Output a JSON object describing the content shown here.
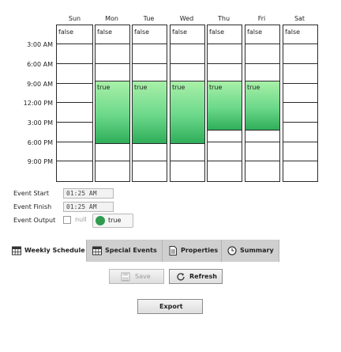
{
  "schedule": {
    "days": [
      "Sun",
      "Mon",
      "Tue",
      "Wed",
      "Thu",
      "Fri",
      "Sat"
    ],
    "time_labels": [
      "3:00 AM",
      "6:00 AM",
      "9:00 AM",
      "12:00 PM",
      "3:00 PM",
      "6:00 PM",
      "9:00 PM"
    ],
    "default_value": "false",
    "active_value": "true",
    "active_block_days": [
      "Mon",
      "Tue",
      "Wed",
      "Thu",
      "Fri"
    ]
  },
  "event": {
    "start_label": "Event Start",
    "start_value": "01:25 AM",
    "finish_label": "Event Finish",
    "finish_value": "01:25 AM",
    "output_label": "Event Output",
    "null_label": "null",
    "output_value": "true",
    "output_color": "#2f9b4f"
  },
  "tabs": [
    {
      "label": "Weekly Schedule",
      "icon": "calendar-grid-icon",
      "active": true
    },
    {
      "label": "Special Events",
      "icon": "calendar-grid-icon",
      "active": false
    },
    {
      "label": "Properties",
      "icon": "document-icon",
      "active": false
    },
    {
      "label": "Summary",
      "icon": "clock-icon",
      "active": false
    }
  ],
  "actions": {
    "save_label": "Save",
    "refresh_label": "Refresh",
    "export_label": "Export"
  },
  "colors": {
    "block_top": "#a8f0a8",
    "block_bottom": "#2fae5a",
    "tabbar": "#cfcfcf"
  }
}
